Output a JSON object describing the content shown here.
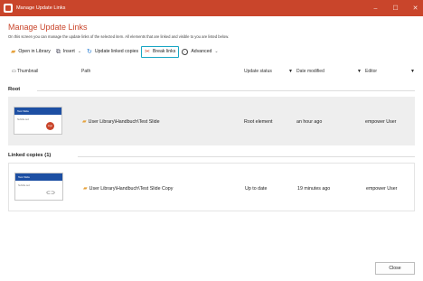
{
  "window": {
    "title": "Manage Update Links",
    "controls": [
      "–",
      "☐",
      "✕"
    ]
  },
  "page": {
    "title": "Manage Update Links",
    "description": "On this screen you can manage the update links of the selected item. All elements that are linked and visible to you are listed below."
  },
  "toolbar": {
    "open_library": "Open in Library",
    "insert": "Insert",
    "update_linked": "Update linked copies",
    "break_links": "Break links",
    "advanced": "Advanced"
  },
  "columns": {
    "thumbnail": "Thumbnail",
    "path": "Path",
    "update_status": "Update status",
    "date_modified": "Date modified",
    "editor": "Editor"
  },
  "root": {
    "label": "Root",
    "thumb_title": "Test Slide",
    "thumb_sub": "Subtitle text",
    "thumb_badge": "logo",
    "path": "User Library\\Handbuch\\Test Slide",
    "status": "Root element",
    "modified": "an hour ago",
    "editor": "empower User"
  },
  "linked": {
    "label": "Linked copies (1)",
    "thumb_title": "Test Slide",
    "thumb_sub": "Subtitle text",
    "path": "User Library\\Handbuch\\Test Slide Copy",
    "status": "Up to date",
    "modified": "19 minutes ago",
    "editor": "empower User"
  },
  "footer": {
    "close": "Close"
  },
  "colors": {
    "accent": "#c9452b",
    "highlight": "#1aa6c4",
    "thumb_bar": "#1d4fa3"
  }
}
